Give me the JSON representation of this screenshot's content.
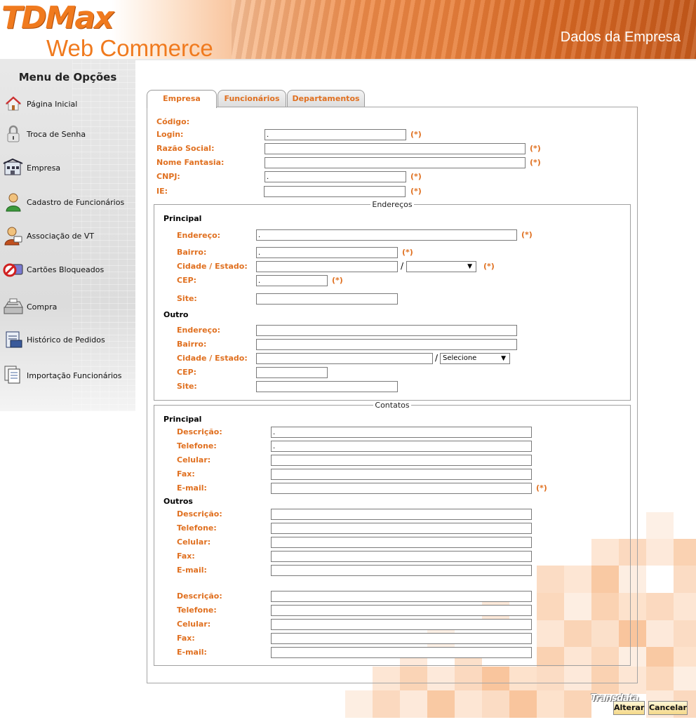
{
  "header": {
    "logo_main": "TDMax",
    "logo_sub": "Web Commerce",
    "page_title": "Dados da Empresa"
  },
  "sidebar": {
    "title": "Menu de Opções",
    "items": [
      {
        "label": "Página Inicial",
        "icon": "home-icon"
      },
      {
        "label": "Troca de Senha",
        "icon": "padlock-icon"
      },
      {
        "label": "Empresa",
        "icon": "building-icon"
      },
      {
        "label": "Cadastro de Funcionários",
        "icon": "person-icon"
      },
      {
        "label": "Associação de VT",
        "icon": "person-card-icon"
      },
      {
        "label": "Cartões Bloqueados",
        "icon": "blocked-card-icon"
      },
      {
        "label": "Compra",
        "icon": "cash-register-icon"
      },
      {
        "label": "Histórico de Pedidos",
        "icon": "order-history-icon"
      },
      {
        "label": "Importação Funcionários",
        "icon": "import-documents-icon"
      }
    ]
  },
  "tabs": [
    {
      "label": "Empresa",
      "active": true
    },
    {
      "label": "Funcionários",
      "active": false
    },
    {
      "label": "Departamentos",
      "active": false
    }
  ],
  "required_marker": "(*)",
  "company": {
    "codigo_label": "Código:",
    "login_label": "Login:",
    "login_value": ".",
    "razao_label": "Razão Social:",
    "razao_value": "",
    "fantasia_label": "Nome Fantasia:",
    "fantasia_value": "",
    "cnpj_label": "CNPJ:",
    "cnpj_value": ".",
    "ie_label": "IE:",
    "ie_value": ""
  },
  "addresses": {
    "legend": "Endereços",
    "principal": {
      "title": "Principal",
      "endereco_label": "Endereço:",
      "endereco_value": ".",
      "bairro_label": "Bairro:",
      "bairro_value": ".",
      "cidade_label": "Cidade / Estado:",
      "cidade_value": "",
      "estado_value": "",
      "cep_label": "CEP:",
      "cep_value": ".",
      "site_label": "Site:",
      "site_value": ""
    },
    "outro": {
      "title": "Outro",
      "endereco_label": "Endereço:",
      "bairro_label": "Bairro:",
      "cidade_label": "Cidade / Estado:",
      "estado_value": "Selecione",
      "cep_label": "CEP:",
      "site_label": "Site:"
    }
  },
  "contacts": {
    "legend": "Contatos",
    "principal": {
      "title": "Principal",
      "descricao_label": "Descrição:",
      "descricao_value": ".",
      "telefone_label": "Telefone:",
      "telefone_value": ".",
      "celular_label": "Celular:",
      "fax_label": "Fax:",
      "email_label": "E-mail:"
    },
    "outros": {
      "title": "Outros",
      "descricao_label": "Descrição:",
      "telefone_label": "Telefone:",
      "celular_label": "Celular:",
      "fax_label": "Fax:",
      "email_label": "E-mail:"
    },
    "extra": {
      "descricao_label": "Descrição:",
      "telefone_label": "Telefone:",
      "celular_label": "Celular:",
      "fax_label": "Fax:",
      "email_label": "E-mail:"
    }
  },
  "buttons": {
    "alterar": "Alterar",
    "cancelar": "Cancelar"
  },
  "brand_footer": "Transdata",
  "colors": {
    "accent": "#e07020",
    "header_orange": "#e8813d",
    "panel_border": "#a5a5a5"
  }
}
